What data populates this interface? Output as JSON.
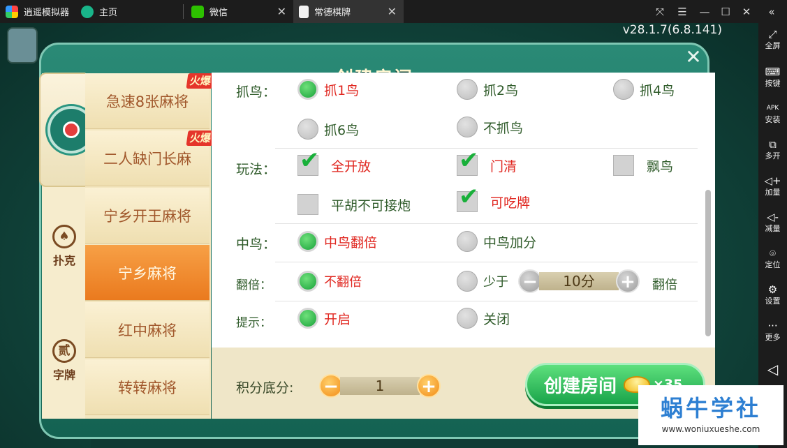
{
  "tabs": [
    {
      "label": "逍遥模拟器",
      "icon": "xiaoyao-logo-icon"
    },
    {
      "label": "主页",
      "icon": "home-app-icon"
    },
    {
      "label": "微信",
      "icon": "wechat-icon"
    },
    {
      "label": "常德棋牌",
      "icon": "game-app-icon"
    }
  ],
  "sidebar": [
    {
      "label": "全屏",
      "icon": "fullscreen-icon"
    },
    {
      "label": "按键",
      "icon": "keyboard-icon"
    },
    {
      "label": "安装",
      "icon": "apk-install-icon"
    },
    {
      "label": "多开",
      "icon": "multi-instance-icon"
    },
    {
      "label": "加量",
      "icon": "volume-up-icon"
    },
    {
      "label": "减量",
      "icon": "volume-down-icon"
    },
    {
      "label": "定位",
      "icon": "location-icon"
    },
    {
      "label": "设置",
      "icon": "settings-icon"
    },
    {
      "label": "更多",
      "icon": "more-icon"
    }
  ],
  "version": "v28.1.7(6.8.141)",
  "dialog": {
    "title": "创建房间",
    "categories": [
      {
        "label": "扑克",
        "glyph": "♠"
      },
      {
        "label": "字牌",
        "glyph": "贰"
      }
    ],
    "hot_badge": "火爆",
    "games": [
      {
        "label": "急速8张麻将",
        "hot": true
      },
      {
        "label": "二人缺门长麻",
        "hot": true
      },
      {
        "label": "宁乡开王麻将",
        "hot": false
      },
      {
        "label": "宁乡麻将",
        "hot": false,
        "selected": true
      },
      {
        "label": "红中麻将",
        "hot": false
      },
      {
        "label": "转转麻将",
        "hot": false
      }
    ],
    "options": {
      "zhuaniao": {
        "label": "抓鸟：",
        "choices": [
          "抓1鸟",
          "抓2鸟",
          "抓4鸟",
          "抓6鸟",
          "不抓鸟"
        ],
        "selected": "抓1鸟"
      },
      "wanfa": {
        "label": "玩法：",
        "choices": [
          "全开放",
          "门清",
          "飘鸟",
          "平胡不可接炮",
          "可吃牌"
        ],
        "checked": [
          "全开放",
          "门清",
          "可吃牌"
        ]
      },
      "zhongniao": {
        "label": "中鸟：",
        "choices": [
          "中鸟翻倍",
          "中鸟加分"
        ],
        "selected": "中鸟翻倍"
      },
      "fanbei": {
        "label": "翻倍：",
        "choices": [
          "不翻倍",
          "少于"
        ],
        "selected": "不翻倍",
        "value": "10分",
        "suffix": "翻倍"
      },
      "tishi": {
        "label": "提示：",
        "choices": [
          "开启",
          "关闭"
        ],
        "selected": "开启"
      }
    },
    "score_label": "积分底分:",
    "score_value": "1",
    "create_label": "创建房间",
    "cost": "×35"
  },
  "watermark": {
    "title": "蜗牛学社",
    "url": "www.woniuxueshe.com"
  },
  "colors": {
    "accent_green": "#18a23a",
    "selected_red": "#e0261f",
    "selected_orange": "#ea7a1e",
    "dialog_teal": "#146252"
  }
}
